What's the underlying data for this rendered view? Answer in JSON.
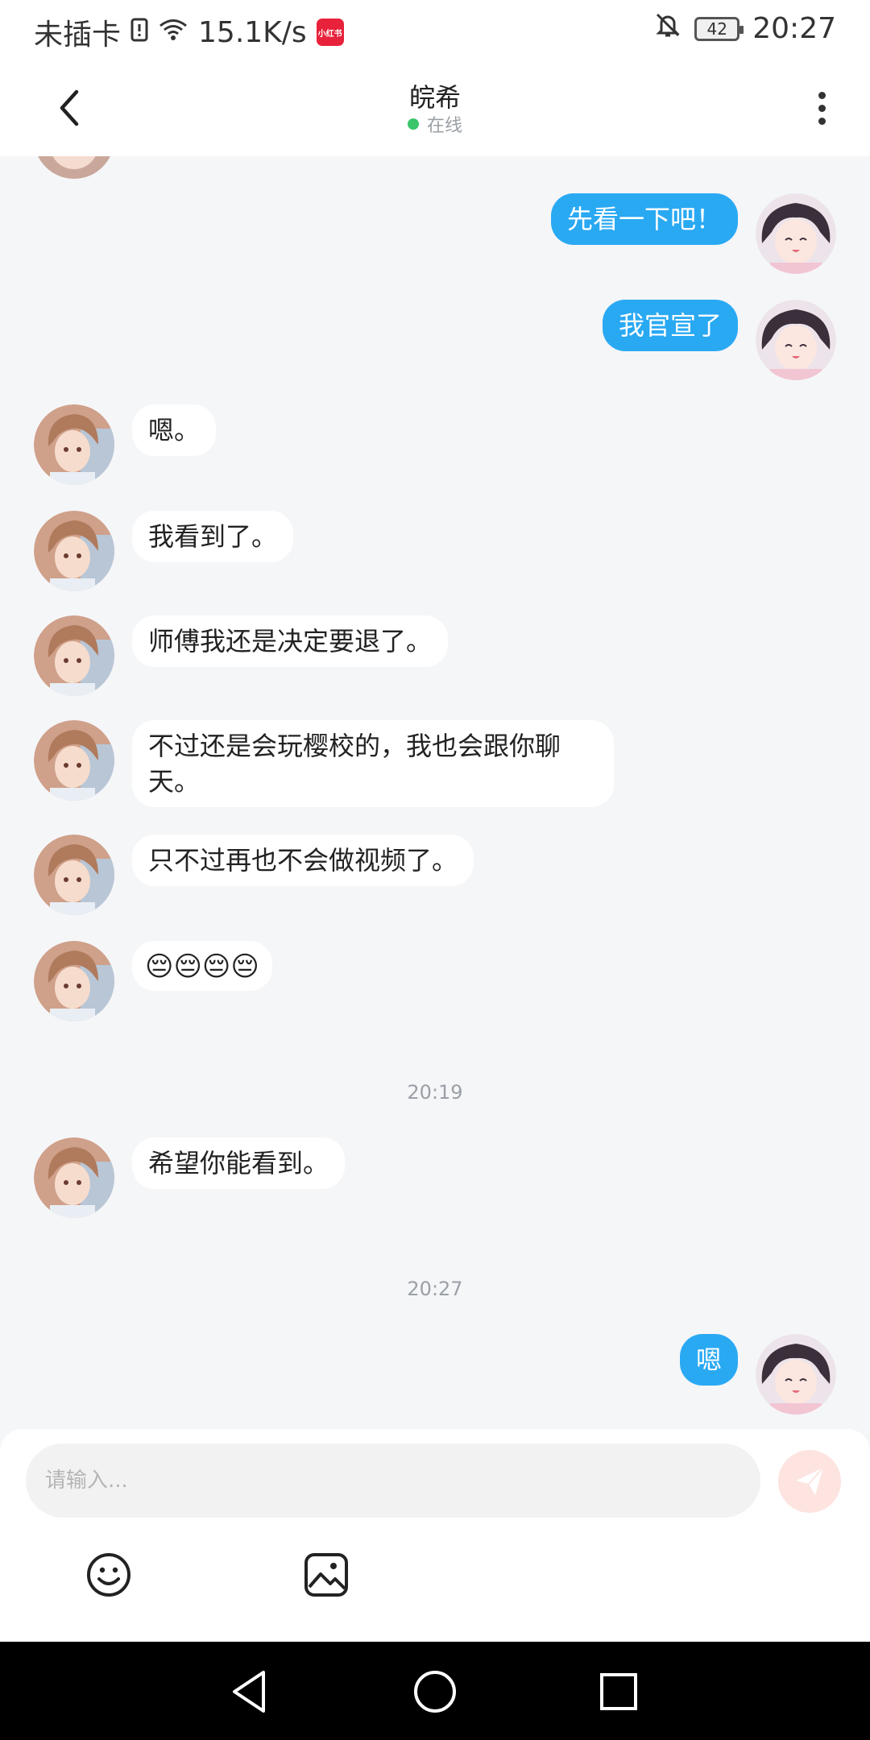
{
  "status_bar": {
    "carrier": "未插卡",
    "speed": "15.1K/s",
    "app_badge": "小红书",
    "battery": "42",
    "time": "20:27"
  },
  "header": {
    "title": "皖希",
    "status": "在线"
  },
  "messages": [
    {
      "side": "right",
      "text": "先看一下吧！"
    },
    {
      "side": "right",
      "text": "我官宣了"
    },
    {
      "side": "left",
      "text": "嗯。"
    },
    {
      "side": "left",
      "text": "我看到了。"
    },
    {
      "side": "left",
      "text": "师傅我还是决定要退了。"
    },
    {
      "side": "left",
      "text": "不过还是会玩樱校的，我也会跟你聊天。"
    },
    {
      "side": "left",
      "text": "只不过再也不会做视频了。"
    },
    {
      "side": "left",
      "text": "😔😔😔😔"
    },
    {
      "side": "left",
      "text": "希望你能看到。"
    },
    {
      "side": "right",
      "text": "嗯"
    }
  ],
  "timestamps": [
    "20:19",
    "20:27"
  ],
  "input": {
    "placeholder": "请输入..."
  },
  "colors": {
    "accent": "#2aa9f3",
    "background": "#f5f6f8",
    "online": "#3cc56b",
    "send_button": "#fde4e1"
  },
  "icons": [
    "back-arrow-icon",
    "more-vertical-icon",
    "send-icon",
    "emoji-icon",
    "image-icon",
    "nav-back-icon",
    "nav-home-icon",
    "nav-recent-icon"
  ]
}
